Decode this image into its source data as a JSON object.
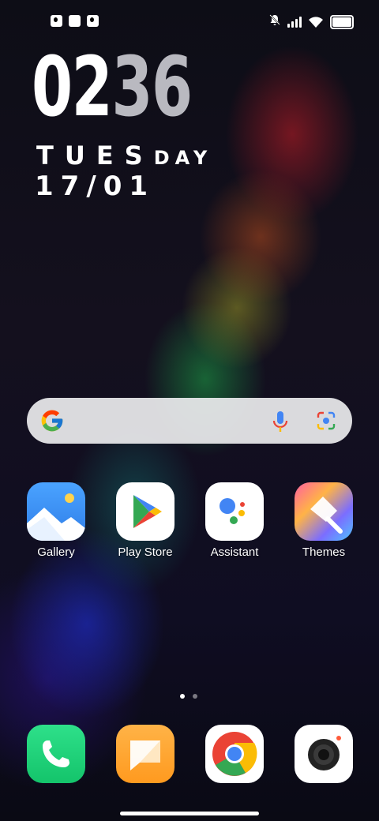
{
  "status_bar": {
    "left_icons": [
      "notification-icon-1",
      "notification-icon-2",
      "notification-icon-3"
    ],
    "right_icons": [
      "silent-icon",
      "signal-icon",
      "wifi-icon",
      "battery-icon"
    ]
  },
  "clock": {
    "hours": "02",
    "minutes": "36",
    "day_big": "TUES",
    "day_small": "DAY",
    "date": "17/01"
  },
  "search_bar": {
    "logo": "google-g-icon",
    "mic": "microphone-icon",
    "lens": "google-lens-icon"
  },
  "apps": [
    {
      "label": "Gallery",
      "icon": "gallery-icon"
    },
    {
      "label": "Play Store",
      "icon": "play-store-icon"
    },
    {
      "label": "Assistant",
      "icon": "assistant-icon"
    },
    {
      "label": "Themes",
      "icon": "themes-icon"
    }
  ],
  "page_indicator": {
    "count": 2,
    "active": 1
  },
  "dock": [
    {
      "icon": "phone-icon"
    },
    {
      "icon": "messages-icon"
    },
    {
      "icon": "chrome-icon"
    },
    {
      "icon": "camera-icon"
    }
  ],
  "colors": {
    "gallery": "#3a8ef0",
    "phone": "#1fd17a",
    "messages": "#ffa532",
    "google_blue": "#4285F4",
    "google_red": "#EA4335",
    "google_yellow": "#FBBC05",
    "google_green": "#34A853"
  }
}
